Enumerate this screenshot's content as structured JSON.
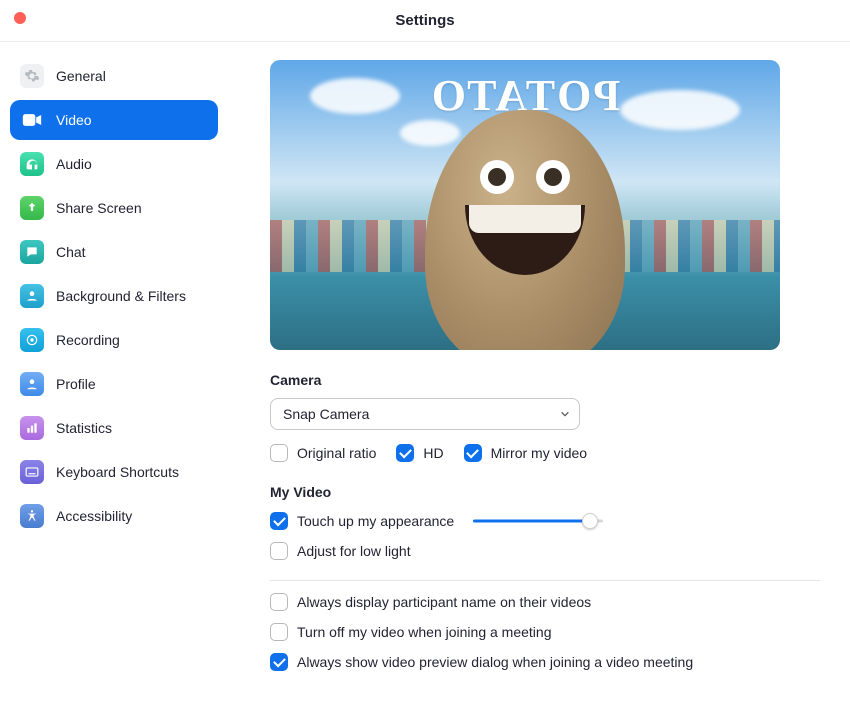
{
  "window": {
    "title": "Settings"
  },
  "sidebar": {
    "items": [
      {
        "label": "General"
      },
      {
        "label": "Video"
      },
      {
        "label": "Audio"
      },
      {
        "label": "Share Screen"
      },
      {
        "label": "Chat"
      },
      {
        "label": "Background & Filters"
      },
      {
        "label": "Recording"
      },
      {
        "label": "Profile"
      },
      {
        "label": "Statistics"
      },
      {
        "label": "Keyboard Shortcuts"
      },
      {
        "label": "Accessibility"
      }
    ],
    "active_index": 1
  },
  "preview": {
    "overlay_text": "POTATO"
  },
  "camera": {
    "section_label": "Camera",
    "selected": "Snap Camera",
    "options": {
      "original_ratio": {
        "label": "Original ratio",
        "checked": false
      },
      "hd": {
        "label": "HD",
        "checked": true
      },
      "mirror": {
        "label": "Mirror my video",
        "checked": true
      }
    }
  },
  "my_video": {
    "section_label": "My Video",
    "touch_up": {
      "label": "Touch up my appearance",
      "checked": true,
      "slider_percent": 90
    },
    "low_light": {
      "label": "Adjust for low light",
      "checked": false
    }
  },
  "meeting_opts": {
    "display_name": {
      "label": "Always display participant name on their videos",
      "checked": false
    },
    "turn_off_join": {
      "label": "Turn off my video when joining a meeting",
      "checked": false
    },
    "preview_dialog": {
      "label": "Always show video preview dialog when joining a video meeting",
      "checked": true
    }
  }
}
